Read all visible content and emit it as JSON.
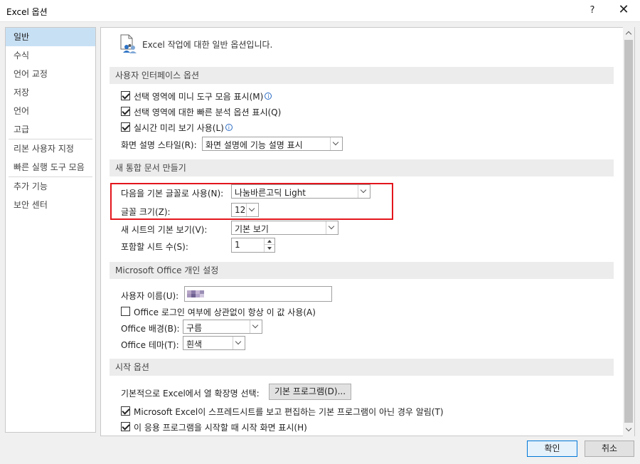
{
  "window": {
    "title": "Excel 옵션",
    "help_label": "?",
    "close_label": "✕"
  },
  "sidebar": {
    "items": [
      {
        "label": "일반"
      },
      {
        "label": "수식"
      },
      {
        "label": "언어 교정"
      },
      {
        "label": "저장"
      },
      {
        "label": "언어"
      },
      {
        "label": "고급"
      },
      {
        "label": "리본 사용자 지정"
      },
      {
        "label": "빠른 실행 도구 모음"
      },
      {
        "label": "추가 기능"
      },
      {
        "label": "보안 센터"
      }
    ],
    "active_index": 0
  },
  "header": {
    "text": "Excel 작업에 대한 일반 옵션입니다.",
    "icon": "general-options-icon"
  },
  "ui_options": {
    "section_title": "사용자 인터페이스 옵션",
    "mini_toolbar": {
      "label": "선택 영역에 미니 도구 모음 표시(M)",
      "checked": true
    },
    "quick_analysis": {
      "label": "선택 영역에 대한 빠른 분석 옵션 표시(Q)",
      "checked": true
    },
    "live_preview": {
      "label": "실시간 미리 보기 사용(L)",
      "checked": true
    },
    "screentip_label": "화면 설명 스타일(R):",
    "screentip_value": "화면 설명에 기능 설명 표시",
    "info_glyph": "i"
  },
  "new_workbook": {
    "section_title": "새 통합 문서 만들기",
    "font_label": "다음을 기본 글꼴로 사용(N):",
    "font_value": "나눔바른고딕 Light",
    "size_label": "글꼴 크기(Z):",
    "size_value": "12",
    "view_label": "새 시트의 기본 보기(V):",
    "view_value": "기본 보기",
    "sheets_label": "포함할 시트 수(S):",
    "sheets_value": "1"
  },
  "office_personal": {
    "section_title": "Microsoft Office 개인 설정",
    "username_label": "사용자 이름(U):",
    "always_use": {
      "label": "Office 로그인 여부에 상관없이 항상 이 값 사용(A)",
      "checked": false
    },
    "background_label": "Office 배경(B):",
    "background_value": "구름",
    "theme_label": "Office 테마(T):",
    "theme_value": "흰색"
  },
  "startup": {
    "section_title": "시작 옵션",
    "ext_label": "기본적으로 Excel에서 열 확장명 선택:",
    "default_programs_button": "기본 프로그램(D)...",
    "not_default_warn": {
      "label": "Microsoft Excel이 스프레드시트를 보고 편집하는 기본 프로그램이 아닌 경우 알림(T)",
      "checked": true
    },
    "show_start_screen": {
      "label": "이 응용 프로그램을 시작할 때 시작 화면 표시(H)",
      "checked": true
    }
  },
  "footer": {
    "ok_label": "확인",
    "cancel_label": "취소"
  },
  "colors": {
    "accent": "#0078d7",
    "selection": "#c7e0f4",
    "highlight": "#e3161c"
  }
}
